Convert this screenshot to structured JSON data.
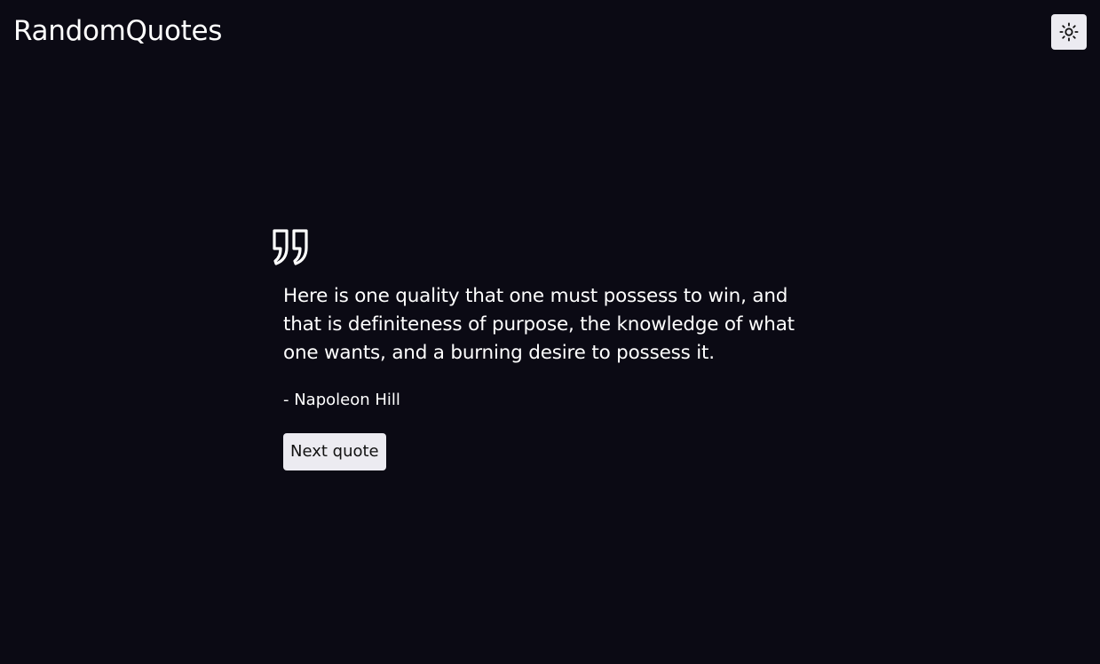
{
  "header": {
    "app_title": "RandomQuotes",
    "theme_toggle_icon": "sun-icon"
  },
  "quote": {
    "icon": "quote-icon",
    "text": "Here is one quality that one must possess to win, and that is definiteness of purpose, the knowledge of what one wants, and a burning desire to possess it.",
    "author": "- Napoleon Hill"
  },
  "actions": {
    "next_label": "Next quote"
  },
  "colors": {
    "background": "#0b0a14",
    "text": "#ffffff",
    "button_bg": "#ecebf1",
    "button_text": "#111111"
  }
}
